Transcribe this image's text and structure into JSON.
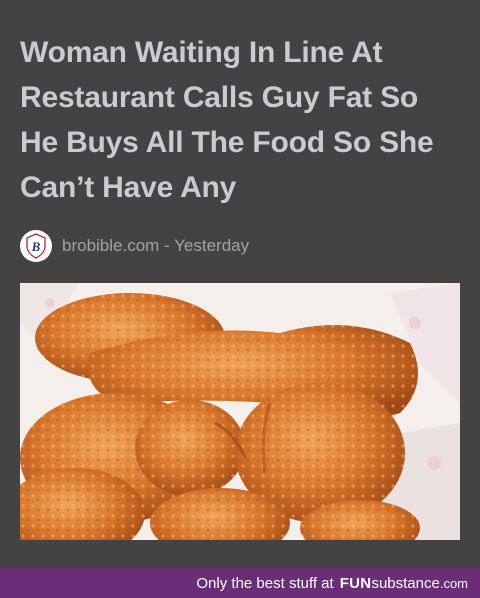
{
  "article": {
    "headline": "Woman Waiting In Line At Restaurant Calls Guy Fat So He Buys All The Food So She Can’t Have Any",
    "source": "brobible.com",
    "separator": " - ",
    "time": "Yesterday",
    "source_logo_letter": "B",
    "image_subject": "fried-chicken-pieces"
  },
  "footer": {
    "tagline": "Only the best stuff at",
    "brand_bold": "FUN",
    "brand_light": "substance",
    "brand_tld": ".com"
  },
  "colors": {
    "background": "#434343",
    "headline": "#c9cbd1",
    "meta": "#9fa2a8",
    "footer_bar": "#6b2d78",
    "logo_accent": "#b3263c"
  }
}
